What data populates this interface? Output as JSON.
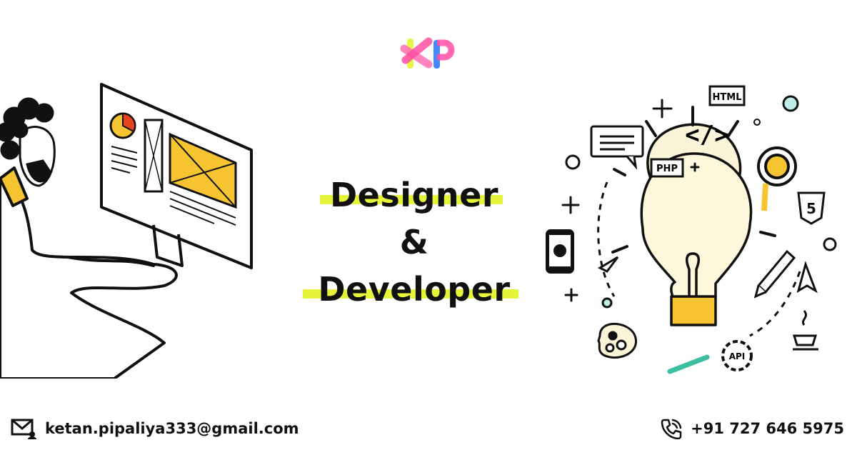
{
  "logo": {
    "text": "KP",
    "colors": [
      "#ff4fa3",
      "#e6f53a",
      "#2f7bff"
    ]
  },
  "headline": {
    "line1": "Designer",
    "line2": "&",
    "line3": "Developer",
    "highlight_color": "#e6f53a"
  },
  "icons": {
    "html": "HTML",
    "php": "PHP",
    "api": "API",
    "code": "</>"
  },
  "contact": {
    "email": "ketan.pipaliya333@gmail.com",
    "phone": "+91 727 646 5975"
  }
}
